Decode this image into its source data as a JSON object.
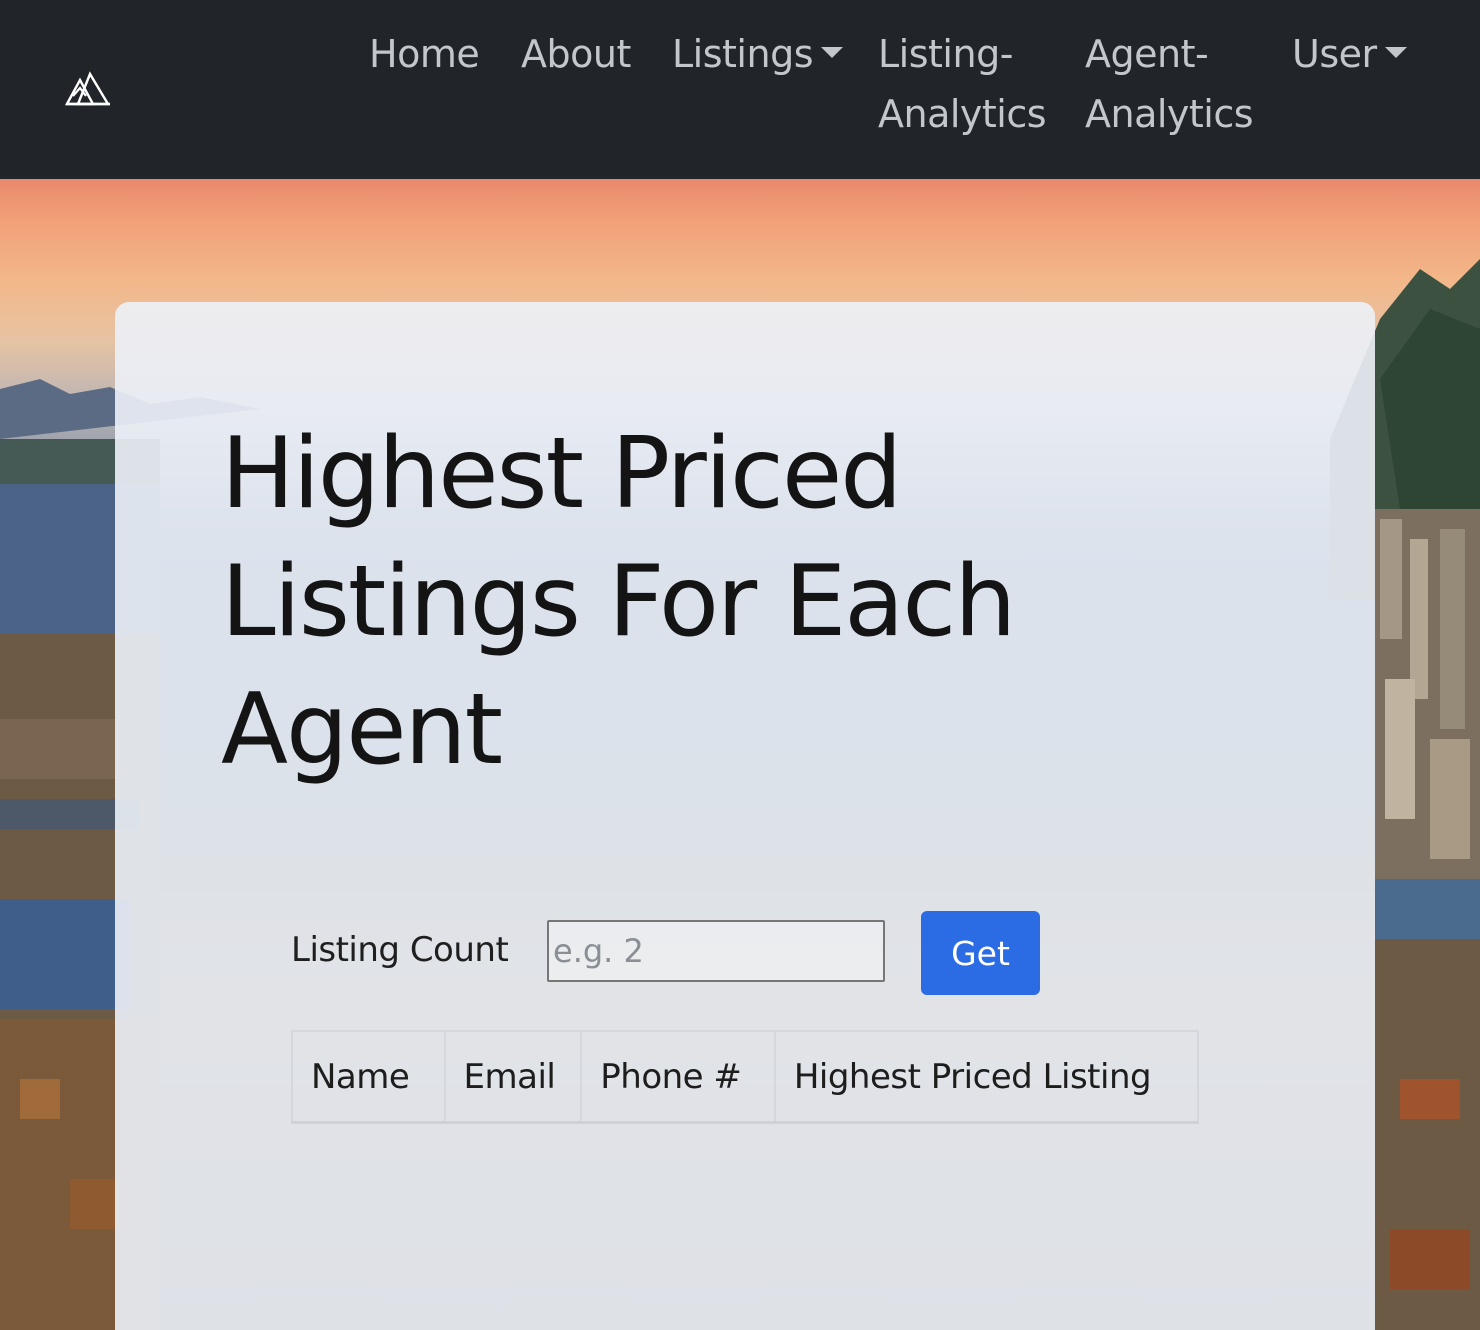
{
  "nav": {
    "brand": "mountain-logo-icon",
    "home": "Home",
    "about": "About",
    "listings": "Listings",
    "listing_analytics_line1": "Listing-",
    "listing_analytics_line2": "Analytics",
    "agent_analytics_line1": "Agent-",
    "agent_analytics_line2": "Analytics",
    "user": "User"
  },
  "main": {
    "title": "Highest Priced Listings For Each Agent",
    "form": {
      "label": "Listing Count",
      "input_value": "",
      "input_placeholder": "e.g. 2",
      "submit_label": "Get"
    },
    "table": {
      "columns": [
        "Name",
        "Email",
        "Phone #",
        "Highest Priced Listing"
      ],
      "rows": []
    }
  },
  "colors": {
    "navbar_bg": "#212529",
    "nav_text": "#c3c6ca",
    "button_bg": "#2b6be4",
    "card_bg": "#ecf1f8"
  }
}
